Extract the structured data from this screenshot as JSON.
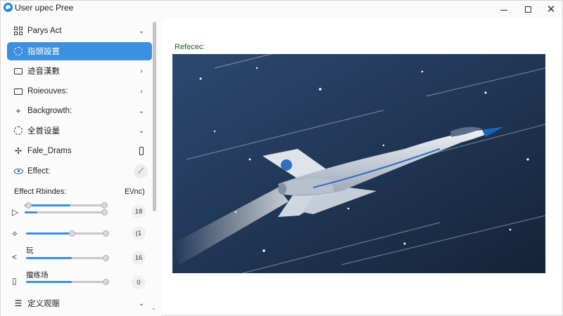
{
  "window": {
    "title": "User upec Pree"
  },
  "sidebar": {
    "items": [
      {
        "label": "Parys Act",
        "icon": "grid-icon",
        "chevron": "⌄"
      },
      {
        "label": "指頭設置",
        "icon": "gear-icon",
        "chevron": "",
        "active": true
      },
      {
        "label": "迹音漢數",
        "icon": "box-icon",
        "chevron": "›"
      },
      {
        "label": "Roieouves:",
        "icon": "folder-icon",
        "chevron": "‹"
      },
      {
        "label": "Backgrowth:",
        "icon": "plus-icon",
        "chevron": "⌄"
      },
      {
        "label": "全首设量",
        "icon": "gear-icon",
        "chevron": "⌄"
      },
      {
        "label": "Fale_Drams",
        "icon": "draw-icon",
        "chevron": ""
      },
      {
        "label": "Effect:",
        "icon": "eye-icon",
        "chevron": ""
      }
    ],
    "effect_section": {
      "label": "Effect Rbindes:",
      "right": "E\\/nc)"
    },
    "sliders": [
      {
        "icon": "play-icon",
        "label": "",
        "value": "18",
        "fill1": 0.55,
        "fill2": 0.15
      },
      {
        "icon": "node-icon",
        "label": "",
        "value": "(1",
        "fill": 0.55
      },
      {
        "icon": "share-icon",
        "label": "玩",
        "value": "16",
        "fill": 0.55
      },
      {
        "icon": "phone-icon",
        "label": "擅练场",
        "value": "0",
        "fill": 0.55
      }
    ],
    "bottom_item": {
      "label": "定义观赈",
      "icon": "list-icon",
      "chevron": "⌄"
    }
  },
  "main": {
    "preview_label": "Refecec:"
  },
  "colors": {
    "accent": "#3d8fe0",
    "preview_bg": "#20344f"
  }
}
